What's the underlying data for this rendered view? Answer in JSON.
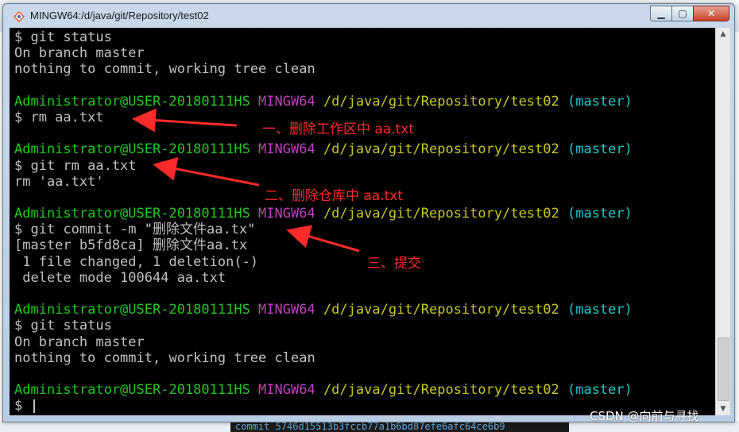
{
  "window": {
    "title": "MINGW64:/d/java/git/Repository/test02",
    "minimize_symbol": "▁",
    "maximize_symbol": "▢",
    "close_symbol": "✕"
  },
  "terminal_lines": [
    [
      {
        "t": "$ git status",
        "c": "default"
      }
    ],
    [
      {
        "t": "On branch master",
        "c": "default"
      }
    ],
    [
      {
        "t": "nothing to commit, working tree clean",
        "c": "default"
      }
    ],
    [
      {
        "t": "",
        "c": "default"
      }
    ],
    [
      {
        "t": "Administrator@USER-20180111HS ",
        "c": "green"
      },
      {
        "t": "MINGW64 ",
        "c": "magenta"
      },
      {
        "t": "/d/java/git/Repository/test02 ",
        "c": "yellow"
      },
      {
        "t": "(master)",
        "c": "cyan"
      }
    ],
    [
      {
        "t": "$ rm aa.txt",
        "c": "default"
      }
    ],
    [
      {
        "t": "",
        "c": "default"
      }
    ],
    [
      {
        "t": "Administrator@USER-20180111HS ",
        "c": "green"
      },
      {
        "t": "MINGW64 ",
        "c": "magenta"
      },
      {
        "t": "/d/java/git/Repository/test02 ",
        "c": "yellow"
      },
      {
        "t": "(master)",
        "c": "cyan"
      }
    ],
    [
      {
        "t": "$ git rm aa.txt",
        "c": "default"
      }
    ],
    [
      {
        "t": "rm 'aa.txt'",
        "c": "default"
      }
    ],
    [
      {
        "t": "",
        "c": "default"
      }
    ],
    [
      {
        "t": "Administrator@USER-20180111HS ",
        "c": "green"
      },
      {
        "t": "MINGW64 ",
        "c": "magenta"
      },
      {
        "t": "/d/java/git/Repository/test02 ",
        "c": "yellow"
      },
      {
        "t": "(master)",
        "c": "cyan"
      }
    ],
    [
      {
        "t": "$ git commit -m \"删除文件aa.tx\"",
        "c": "default"
      }
    ],
    [
      {
        "t": "[master b5fd8ca] 删除文件aa.tx",
        "c": "default"
      }
    ],
    [
      {
        "t": " 1 file changed, 1 deletion(-)",
        "c": "default"
      }
    ],
    [
      {
        "t": " delete mode 100644 aa.txt",
        "c": "default"
      }
    ],
    [
      {
        "t": "",
        "c": "default"
      }
    ],
    [
      {
        "t": "Administrator@USER-20180111HS ",
        "c": "green"
      },
      {
        "t": "MINGW64 ",
        "c": "magenta"
      },
      {
        "t": "/d/java/git/Repository/test02 ",
        "c": "yellow"
      },
      {
        "t": "(master)",
        "c": "cyan"
      }
    ],
    [
      {
        "t": "$ git status",
        "c": "default"
      }
    ],
    [
      {
        "t": "On branch master",
        "c": "default"
      }
    ],
    [
      {
        "t": "nothing to commit, working tree clean",
        "c": "default"
      }
    ],
    [
      {
        "t": "",
        "c": "default"
      }
    ],
    [
      {
        "t": "Administrator@USER-20180111HS ",
        "c": "green"
      },
      {
        "t": "MINGW64 ",
        "c": "magenta"
      },
      {
        "t": "/d/java/git/Repository/test02 ",
        "c": "yellow"
      },
      {
        "t": "(master)",
        "c": "cyan"
      }
    ],
    [
      {
        "t": "$ ",
        "c": "default",
        "cursor": true
      }
    ]
  ],
  "annotations": {
    "step1": "一、删除工作区中   aa.txt",
    "step2": "二、删除仓库中   aa.txt",
    "step3": "三、提交"
  },
  "background_strip_text": "commit 5746d15513b3fccb77a1b6bd87efe6afc64ce6b9",
  "watermark": "CSDN @向前与寻找",
  "colors": {
    "terminal_bg": "#000000",
    "text_default": "#c0c0c0",
    "prompt_user": "#1fc81f",
    "prompt_mingw": "#c040c0",
    "prompt_path": "#c8c81e",
    "prompt_branch": "#1fc8c8",
    "annotation_red": "#ff2a2a"
  }
}
